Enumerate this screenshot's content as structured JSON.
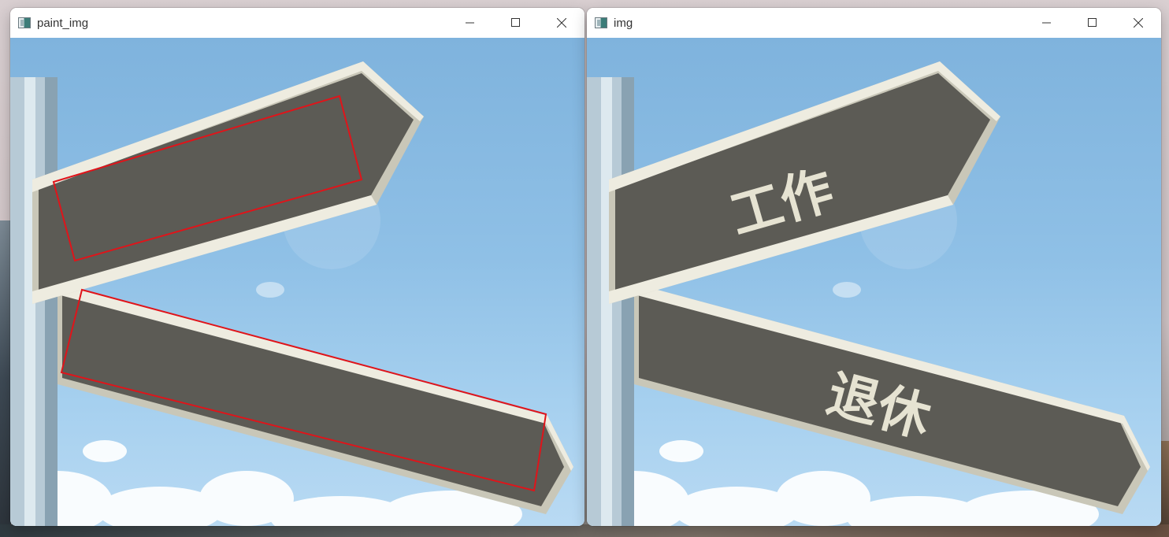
{
  "windows": [
    {
      "id": "left",
      "title": "paint_img",
      "controls": {
        "minimize_icon": "minimize-icon",
        "maximize_icon": "maximize-icon",
        "close_icon": "close-icon"
      },
      "image": {
        "sign_top_text": "",
        "sign_bottom_text": "",
        "has_detection_boxes": true,
        "box_color": "#e0141a"
      }
    },
    {
      "id": "right",
      "title": "img",
      "controls": {
        "minimize_icon": "minimize-icon",
        "maximize_icon": "maximize-icon",
        "close_icon": "close-icon"
      },
      "image": {
        "sign_top_text": "工作",
        "sign_bottom_text": "退休",
        "has_detection_boxes": false
      }
    }
  ],
  "colors": {
    "sky_top": "#7fb3dd",
    "sky_bottom": "#b9daf3",
    "sign_wood": "#5c5b55",
    "sign_border": "#eeece0",
    "pole": "#b5c8d3",
    "sign_text": "#e6e3d2"
  }
}
